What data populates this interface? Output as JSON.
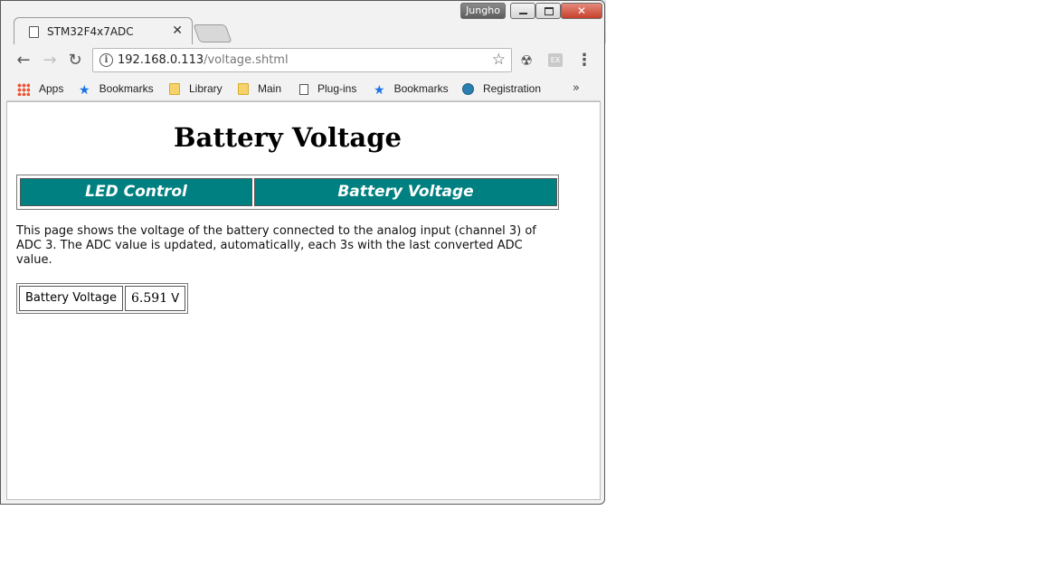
{
  "tab": {
    "title": "STM32F4x7ADC"
  },
  "window": {
    "user": "Jungho"
  },
  "address": {
    "host": "192.168.0.113",
    "path": "/voltage.shtml"
  },
  "bookmarks": [
    {
      "label": "Apps",
      "icon": "apps-icon"
    },
    {
      "label": "Bookmarks",
      "icon": "star-icon"
    },
    {
      "label": "Library",
      "icon": "folder-icon"
    },
    {
      "label": "Main",
      "icon": "folder-icon"
    },
    {
      "label": "Plug-ins",
      "icon": "page-icon"
    },
    {
      "label": "Bookmarks",
      "icon": "star-icon"
    },
    {
      "label": "Registration",
      "icon": "registration-icon"
    }
  ],
  "page": {
    "heading": "Battery Voltage",
    "nav": {
      "led": "LED Control",
      "battery": "Battery Voltage"
    },
    "description": "This page shows the voltage of the battery connected to the analog input (channel 3) of ADC 3. The ADC value is updated, automatically, each 3s with the last converted ADC value.",
    "voltage_label": "Battery Voltage",
    "voltage_value": "6.591",
    "voltage_unit": "V"
  },
  "colors": {
    "nav_bg": "#008080"
  }
}
